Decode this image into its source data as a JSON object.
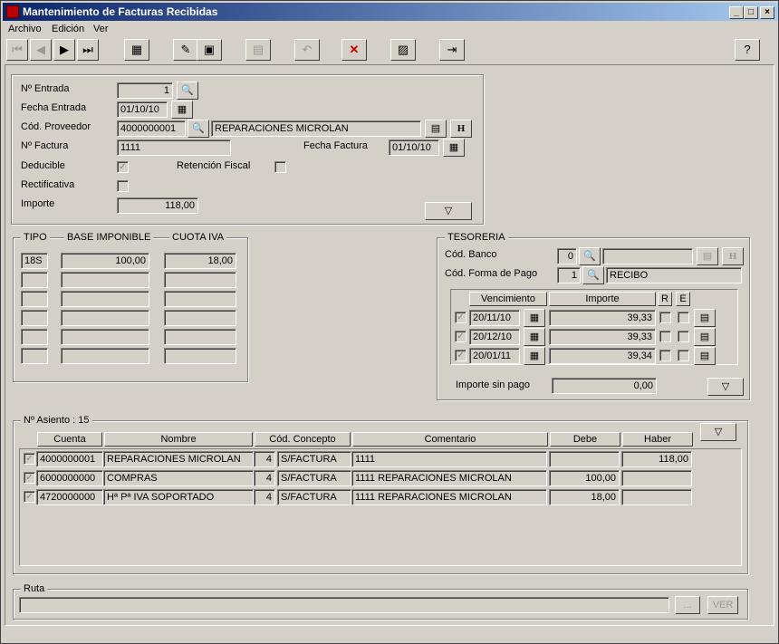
{
  "window": {
    "title": "Mantenimiento de Facturas Recibidas"
  },
  "menu": [
    "Archivo",
    "Edición",
    "Ver"
  ],
  "toolbar": {
    "nav_first": "|◀",
    "nav_prev": "◀",
    "nav_next": "▶",
    "nav_last": "▶|"
  },
  "factura": {
    "n_entrada_label": "Nº Entrada",
    "n_entrada": "1",
    "fecha_entrada_label": "Fecha Entrada",
    "fecha_entrada": "01/10/10",
    "cod_proveedor_label": "Cód. Proveedor",
    "cod_proveedor": "4000000001",
    "proveedor_nombre": "REPARACIONES MICROLAN",
    "n_factura_label": "Nº Factura",
    "n_factura": "1111",
    "fecha_factura_label": "Fecha Factura",
    "fecha_factura": "01/10/10",
    "deducible_label": "Deducible",
    "retencion_label": "Retención Fiscal",
    "rectificativa_label": "Rectificativa",
    "importe_label": "Importe",
    "importe": "118,00"
  },
  "iva": {
    "col_tipo": "TIPO",
    "col_base": "BASE IMPONIBLE",
    "col_cuota": "CUOTA IVA",
    "rows": [
      {
        "tipo": "18S",
        "base": "100,00",
        "cuota": "18,00"
      },
      {
        "tipo": "",
        "base": "",
        "cuota": ""
      },
      {
        "tipo": "",
        "base": "",
        "cuota": ""
      },
      {
        "tipo": "",
        "base": "",
        "cuota": ""
      },
      {
        "tipo": "",
        "base": "",
        "cuota": ""
      },
      {
        "tipo": "",
        "base": "",
        "cuota": ""
      }
    ]
  },
  "tesoreria": {
    "title": "TESORERIA",
    "cod_banco_label": "Cód. Banco",
    "cod_banco": "0",
    "cod_forma_pago_label": "Cód. Forma de Pago",
    "cod_forma_pago": "1",
    "forma_pago_nombre": "RECIBO",
    "col_vencimiento": "Vencimiento",
    "col_importe": "Importe",
    "col_r": "R",
    "col_e": "E",
    "vencimientos": [
      {
        "fecha": "20/11/10",
        "importe": "39,33"
      },
      {
        "fecha": "20/12/10",
        "importe": "39,33"
      },
      {
        "fecha": "20/01/11",
        "importe": "39,34"
      }
    ],
    "importe_sin_pago_label": "Importe sin pago",
    "importe_sin_pago": "0,00"
  },
  "asiento": {
    "title": "Nº Asiento : 15",
    "cols": {
      "cuenta": "Cuenta",
      "nombre": "Nombre",
      "concepto": "Cód. Concepto",
      "comentario": "Comentario",
      "debe": "Debe",
      "haber": "Haber"
    },
    "rows": [
      {
        "cuenta": "4000000001",
        "nombre": "REPARACIONES MICROLAN",
        "cod": "4",
        "concepto": "S/FACTURA",
        "comentario": "1111",
        "debe": "",
        "haber": "118,00"
      },
      {
        "cuenta": "6000000000",
        "nombre": "COMPRAS",
        "cod": "4",
        "concepto": "S/FACTURA",
        "comentario": "1111 REPARACIONES MICROLAN",
        "debe": "100,00",
        "haber": ""
      },
      {
        "cuenta": "4720000000",
        "nombre": "Hª Pª IVA SOPORTADO",
        "cod": "4",
        "concepto": "S/FACTURA",
        "comentario": "1111 REPARACIONES MICROLAN",
        "debe": "18,00",
        "haber": ""
      }
    ]
  },
  "ruta": {
    "title": "Ruta",
    "value": "",
    "browse": "...",
    "ver": "VER"
  }
}
